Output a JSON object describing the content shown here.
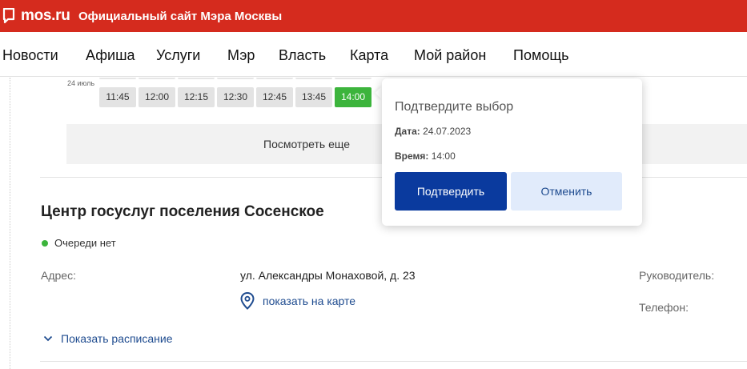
{
  "header": {
    "logo": "mos.ru",
    "site_title": "Официальный сайт Мэра Москвы",
    "brand_color": "#d52b1e"
  },
  "nav": {
    "items": [
      "Новости",
      "Афиша",
      "Услуги",
      "Мэр",
      "Власть",
      "Карта",
      "Мой район",
      "Помощь"
    ]
  },
  "schedule": {
    "date_label": "24 июль",
    "times": [
      "11:45",
      "12:00",
      "12:15",
      "12:30",
      "12:45",
      "13:45",
      "14:00"
    ],
    "selected_time": "14:00",
    "more_button": "Посмотреть еще"
  },
  "confirm_popup": {
    "title": "Подтвердите выбор",
    "date_label": "Дата:",
    "date_value": "24.07.2023",
    "time_label": "Время:",
    "time_value": "14:00",
    "confirm_button": "Подтвердить",
    "cancel_button": "Отменить"
  },
  "center": {
    "title": "Центр госуслуг поселения Сосенское",
    "queue_status": "Очереди нет",
    "address_label": "Адрес:",
    "address_value": "ул. Александры Монаховой, д. 23",
    "map_link": "показать на карте",
    "manager_label": "Руководитель:",
    "phone_label": "Телефон:",
    "schedule_link": "Показать расписание"
  }
}
